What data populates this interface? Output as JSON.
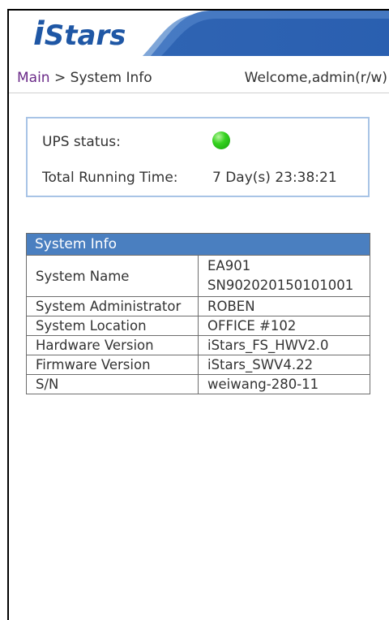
{
  "brand": {
    "logo_text_prefix": "i",
    "logo_text_rest": "Stars",
    "color": "#1f57a5"
  },
  "nav": {
    "breadcrumb_root": "Main",
    "breadcrumb_sep": " > ",
    "breadcrumb_current": "System Info",
    "welcome": "Welcome,admin(r/w)"
  },
  "status": {
    "ups_label": "UPS status:",
    "ups_indicator": "green-status-led",
    "ups_color": "#35d21f",
    "runtime_label": "Total Running Time:",
    "runtime_value": "7 Day(s) 23:38:21"
  },
  "system_info": {
    "title": "System Info",
    "header_color": "#4a7fc0",
    "rows": [
      {
        "label": "System Name",
        "value_lines": [
          "EA901",
          "SN902020150101001"
        ]
      },
      {
        "label": "System Administrator",
        "value": "ROBEN"
      },
      {
        "label": "System Location",
        "value": "OFFICE #102"
      },
      {
        "label": "Hardware Version",
        "value": "iStars_FS_HWV2.0"
      },
      {
        "label": "Firmware Version",
        "value": "iStars_SWV4.22"
      },
      {
        "label": "S/N",
        "value": "weiwang-280-11"
      }
    ]
  }
}
